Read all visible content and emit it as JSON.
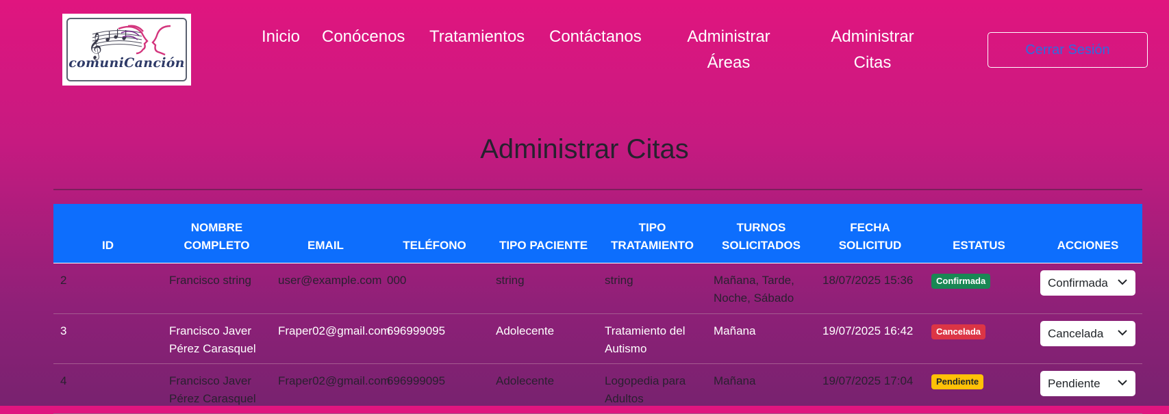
{
  "logo": {
    "text": "comuniCanción"
  },
  "nav": {
    "links": [
      "Inicio",
      "Conócenos",
      "Tratamientos",
      "Contáctanos"
    ],
    "admin_areas": [
      "Administrar",
      "Áreas"
    ],
    "admin_citas": [
      "Administrar",
      "Citas"
    ],
    "logout": "Cerrar Sesión"
  },
  "page": {
    "title": "Administrar Citas"
  },
  "table": {
    "headers": [
      [
        "ID"
      ],
      [
        "NOMBRE",
        "COMPLETO"
      ],
      [
        "EMAIL"
      ],
      [
        "TELÉFONO"
      ],
      [
        "TIPO PACIENTE"
      ],
      [
        "TIPO",
        "TRATAMIENTO"
      ],
      [
        "TURNOS",
        "SOLICITADOS"
      ],
      [
        "FECHA",
        "SOLICITUD"
      ],
      [
        "ESTATUS"
      ],
      [
        "ACCIONES"
      ]
    ],
    "rows": [
      {
        "id": "2",
        "nombre": "Francisco string",
        "email": "user@example.com",
        "telefono": "000",
        "tipo_paciente": "string",
        "tipo_tratamiento": "string",
        "turnos": "Mañana, Tarde, Noche, Sábado",
        "fecha": "18/07/2025 15:36",
        "estatus": "Confirmada",
        "accion": "Confirmada"
      },
      {
        "id": "3",
        "nombre": "Francisco Javer Pérez Carasquel",
        "email": "Fraper02@gmail.com",
        "telefono": "696999095",
        "tipo_paciente": "Adolecente",
        "tipo_tratamiento": "Tratamiento del Autismo",
        "turnos": "Mañana",
        "fecha": "19/07/2025 16:42",
        "estatus": "Cancelada",
        "accion": "Cancelada"
      },
      {
        "id": "4",
        "nombre": "Francisco Javer Pérez Carasquel",
        "email": "Fraper02@gmail.com",
        "telefono": "696999095",
        "tipo_paciente": "Adolecente",
        "tipo_tratamiento": "Logopedia para Adultos",
        "turnos": "Mañana",
        "fecha": "19/07/2025 17:04",
        "estatus": "Pendiente",
        "accion": "Pendiente"
      }
    ]
  },
  "colors": {
    "header_bg": "#0d6efd",
    "confirmada": "#198754",
    "cancelada": "#dc3545",
    "pendiente": "#ffc107",
    "logout_text": "#2f6bdf"
  },
  "icons": {
    "select_arrow": "chevron-down-icon"
  }
}
